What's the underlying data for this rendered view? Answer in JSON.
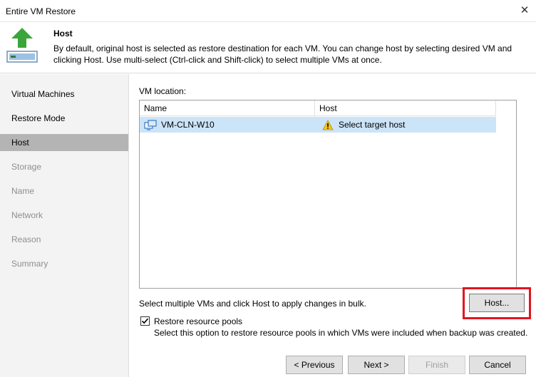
{
  "window": {
    "title": "Entire VM Restore"
  },
  "header": {
    "title": "Host",
    "description": "By default, original host is selected as restore destination for each VM. You can change host by selecting desired VM and clicking Host. Use multi-select (Ctrl-click and Shift-click) to select multiple VMs at once."
  },
  "sidebar": {
    "steps": [
      {
        "label": "Virtual Machines",
        "state": "done"
      },
      {
        "label": "Restore Mode",
        "state": "done"
      },
      {
        "label": "Host",
        "state": "active"
      },
      {
        "label": "Storage",
        "state": "future"
      },
      {
        "label": "Name",
        "state": "future"
      },
      {
        "label": "Network",
        "state": "future"
      },
      {
        "label": "Reason",
        "state": "future"
      },
      {
        "label": "Summary",
        "state": "future"
      }
    ]
  },
  "main": {
    "vm_location_label": "VM location:",
    "table": {
      "columns": [
        "Name",
        "Host"
      ],
      "rows": [
        {
          "name": "VM-CLN-W10",
          "host": "Select target host",
          "host_icon": "warning-icon",
          "name_icon": "vm-icon"
        }
      ]
    },
    "bulk_text": "Select multiple VMs and click Host to apply changes in bulk.",
    "host_button": "Host...",
    "restore_pools": {
      "checked": true,
      "label": "Restore resource pools",
      "description": "Select this option to restore resource pools in which VMs were included when backup was created."
    }
  },
  "footer": {
    "previous": "< Previous",
    "next": "Next >",
    "finish": "Finish",
    "cancel": "Cancel"
  },
  "colors": {
    "selected_row": "#cce4f7",
    "active_step": "#b4b4b4",
    "highlight": "#e3141f",
    "header_arrow": "#3aa53a"
  }
}
